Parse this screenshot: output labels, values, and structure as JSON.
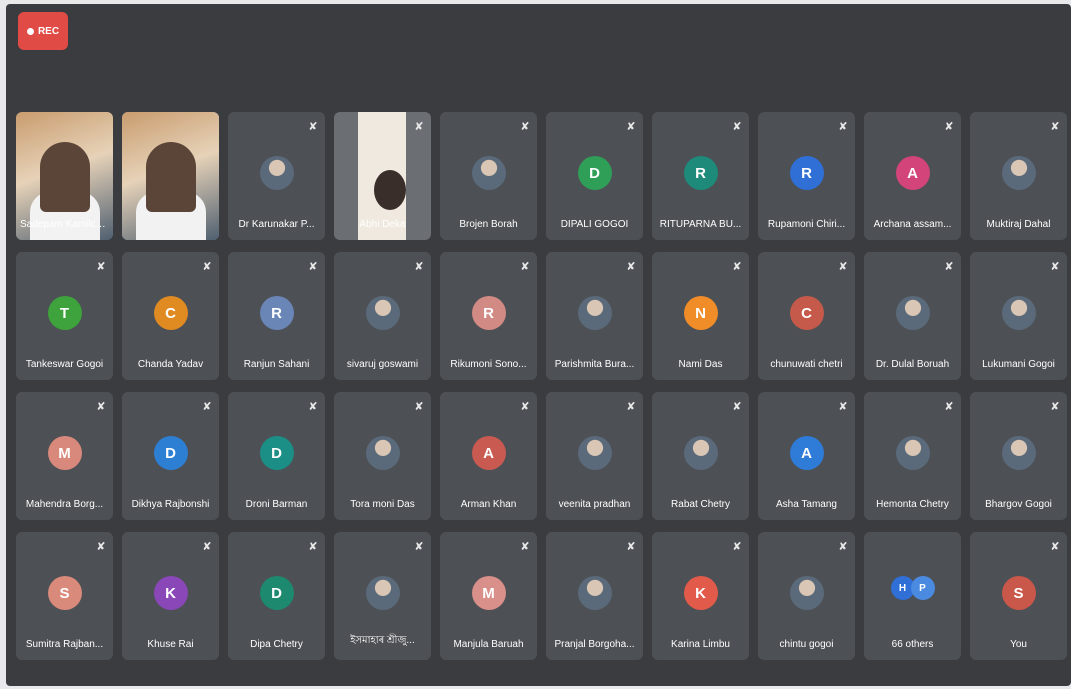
{
  "recording": {
    "label": "REC",
    "color": "#e14b45"
  },
  "participants": [
    {
      "name": "Sadepam Kamilcoze",
      "type": "video",
      "muted": false
    },
    {
      "name": "",
      "type": "video",
      "active": true,
      "muted": false
    },
    {
      "name": "Dr Karunakar P...",
      "type": "photo",
      "muted": true
    },
    {
      "name": "Abhi Deka",
      "type": "video-partial",
      "muted": true
    },
    {
      "name": "Brojen Borah",
      "type": "photo",
      "muted": true
    },
    {
      "name": "DIPALI GOGOI",
      "type": "initial",
      "initial": "D",
      "color": "#2f9e57",
      "muted": true
    },
    {
      "name": "RITUPARNA BU...",
      "type": "initial",
      "initial": "R",
      "color": "#1d8a7a",
      "muted": true
    },
    {
      "name": "Rupamoni Chiri...",
      "type": "initial",
      "initial": "R",
      "color": "#2f6fd6",
      "muted": true
    },
    {
      "name": "Archana assam...",
      "type": "initial",
      "initial": "A",
      "color": "#d2447a",
      "muted": true
    },
    {
      "name": "Muktiraj Dahal",
      "type": "photo",
      "muted": true
    },
    {
      "name": "Tankeswar Gogoi",
      "type": "initial",
      "initial": "T",
      "color": "#3ea33c",
      "muted": true
    },
    {
      "name": "Chanda Yadav",
      "type": "initial",
      "initial": "C",
      "color": "#e08a22",
      "muted": true
    },
    {
      "name": "Ranjun Sahani",
      "type": "initial",
      "initial": "R",
      "color": "#6a86b7",
      "muted": true
    },
    {
      "name": "sivaruj goswami",
      "type": "photo",
      "muted": true
    },
    {
      "name": "Rikumoni Sono...",
      "type": "initial",
      "initial": "R",
      "color": "#d28a84",
      "muted": true
    },
    {
      "name": "Parishmita Bura...",
      "type": "photo",
      "muted": true
    },
    {
      "name": "Nami Das",
      "type": "initial",
      "initial": "N",
      "color": "#f08d28",
      "muted": true
    },
    {
      "name": "chunuwati chetri",
      "type": "initial",
      "initial": "C",
      "color": "#c65a4a",
      "muted": true
    },
    {
      "name": "Dr. Dulal Boruah",
      "type": "photo",
      "muted": true
    },
    {
      "name": "Lukumani Gogoi",
      "type": "photo",
      "muted": true
    },
    {
      "name": "Mahendra Borg...",
      "type": "initial",
      "initial": "M",
      "color": "#d8897c",
      "muted": true
    },
    {
      "name": "Dikhya Rajbonshi",
      "type": "initial",
      "initial": "D",
      "color": "#2d7fd4",
      "muted": true
    },
    {
      "name": "Droni Barman",
      "type": "initial",
      "initial": "D",
      "color": "#1b8e86",
      "muted": true
    },
    {
      "name": "Tora moni Das",
      "type": "photo",
      "muted": true
    },
    {
      "name": "Arman Khan",
      "type": "initial",
      "initial": "A",
      "color": "#c95a52",
      "muted": true
    },
    {
      "name": "veenita pradhan",
      "type": "photo",
      "muted": true
    },
    {
      "name": "Rabat Chetry",
      "type": "photo",
      "muted": true
    },
    {
      "name": "Asha Tamang",
      "type": "initial",
      "initial": "A",
      "color": "#2f7bd8",
      "muted": true
    },
    {
      "name": "Hemonta Chetry",
      "type": "photo",
      "muted": true
    },
    {
      "name": "Bhargov Gogoi",
      "type": "photo",
      "muted": true
    },
    {
      "name": "Sumitra Rajban...",
      "type": "initial",
      "initial": "S",
      "color": "#d98a7b",
      "muted": true
    },
    {
      "name": "Khuse Rai",
      "type": "initial",
      "initial": "K",
      "color": "#8a47b8",
      "muted": true
    },
    {
      "name": "Dipa Chetry",
      "type": "initial",
      "initial": "D",
      "color": "#1d8a6f",
      "muted": true
    },
    {
      "name": "ইসমাহাৰ শ্ৰীজু...",
      "type": "photo",
      "muted": true
    },
    {
      "name": "Manjula Baruah",
      "type": "initial",
      "initial": "M",
      "color": "#d98f8a",
      "muted": true
    },
    {
      "name": "Pranjal Borgoha...",
      "type": "photo",
      "muted": true
    },
    {
      "name": "Karina Limbu",
      "type": "initial",
      "initial": "K",
      "color": "#e25a4a",
      "muted": true
    },
    {
      "name": "chintu gogoi",
      "type": "photo",
      "muted": true
    },
    {
      "name": "66 others",
      "type": "others",
      "muted": false
    },
    {
      "name": "You",
      "type": "initial",
      "initial": "S",
      "color": "#c9574a",
      "muted": true
    }
  ],
  "others_avatars": [
    {
      "initial": "H",
      "color": "#2f6fd6"
    },
    {
      "initial": "P",
      "color": "#4a8ae0"
    }
  ],
  "icons": {
    "mic_off": "mic-off-icon",
    "record": "record-dot-icon"
  }
}
